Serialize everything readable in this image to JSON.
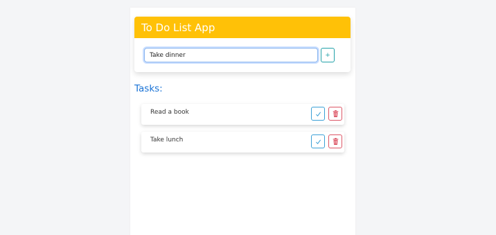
{
  "app": {
    "title": "To Do List App"
  },
  "input": {
    "value": "Take dinner",
    "add_label": "+"
  },
  "tasks_heading": "Tasks:",
  "tasks": [
    {
      "text": "Read a book"
    },
    {
      "text": "Take lunch"
    }
  ],
  "icons": {
    "check": "check-icon",
    "delete": "trash-icon"
  },
  "colors": {
    "header": "#ffc107",
    "heading": "#1a73d6",
    "check": "#3aa0d6",
    "delete": "#dc5565",
    "add": "#20a0a8"
  }
}
